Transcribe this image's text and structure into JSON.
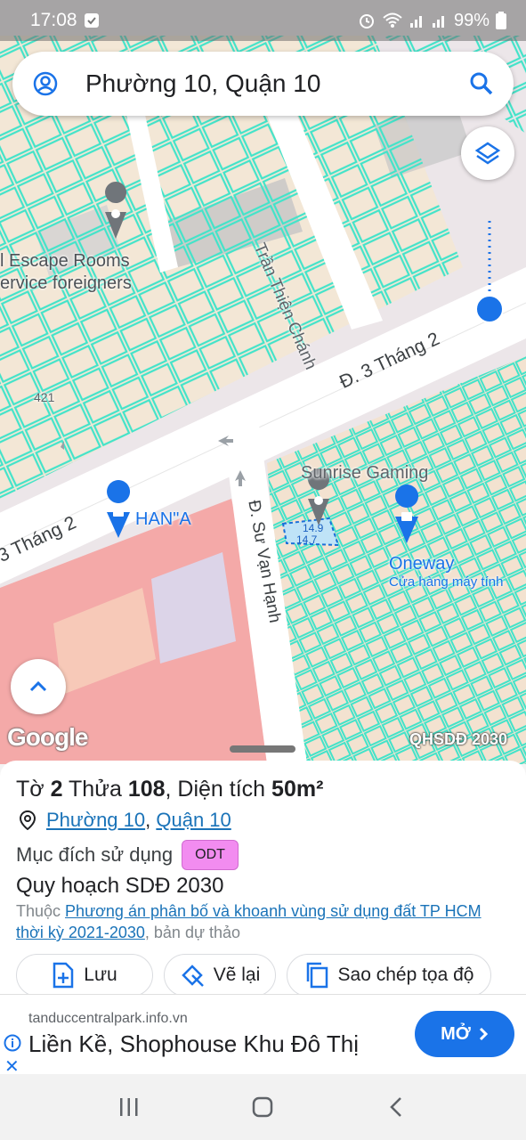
{
  "status_bar": {
    "time": "17:08",
    "battery": "99%"
  },
  "search": {
    "query": "Phường 10, Quận 10"
  },
  "map": {
    "labels": {
      "escape_rooms_1": "l Escape Rooms",
      "escape_rooms_2": "ervice foreigners",
      "tran_thien_chanh": "Trần Thiện Chánh",
      "d3thang2_top": "Đ. 3 Tháng 2",
      "d3thang2_left": "3 Tháng 2",
      "house_num": "421",
      "sunrise": "Sunrise Gaming",
      "hana": "HAN\"A",
      "su_van_hanh": "Đ. Sư Vạn Hạnh",
      "oneway": "Oneway",
      "oneway_sub": "Cửa hàng máy tính",
      "dim1": "14.9",
      "dim2": "14.7"
    },
    "google": "Google",
    "layer_name": "QHSDĐ 2030"
  },
  "parcel": {
    "to_label": "Tờ",
    "to": "2",
    "thua_label": "Thửa",
    "thua": "108",
    "area_label": ", Diện tích",
    "area": "50m²",
    "ward": "Phường 10",
    "district": "Quận 10",
    "purpose_label": "Mục đích sử dụng",
    "purpose_code": "ODT",
    "plan": "Quy hoạch SDĐ 2030",
    "note_prefix": "Thuộc",
    "note_link": "Phương án phân bố và khoanh vùng sử dụng đất TP HCM thời kỳ 2021-2030",
    "note_suffix": ", bản dự thảo"
  },
  "actions": {
    "save": "Lưu",
    "redraw": "Vẽ lại",
    "copy": "Sao chép tọa độ"
  },
  "ad": {
    "domain": "tanduccentralpark.info.vn",
    "headline": "Liền Kề, Shophouse Khu Đô Thị",
    "open": "MỞ"
  },
  "colors": {
    "parcel_line": "#3de0c8",
    "link": "#1a73b8",
    "badge": "#f28cf0",
    "accent": "#1a73e8"
  }
}
